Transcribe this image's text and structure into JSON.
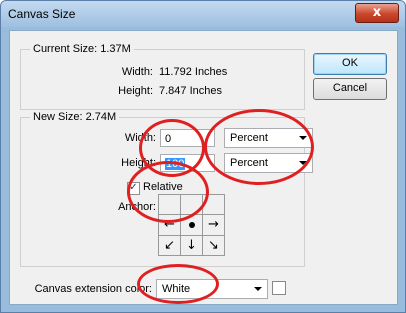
{
  "window": {
    "title": "Canvas Size",
    "close_label": "x"
  },
  "current": {
    "legend": "Current Size: 1.37M",
    "width_label": "Width:",
    "width_value": "11.792 Inches",
    "height_label": "Height:",
    "height_value": "7.847 Inches"
  },
  "new": {
    "legend": "New Size: 2.74M",
    "width_label": "Width:",
    "width_value": "0",
    "width_unit": "Percent",
    "height_label": "Height:",
    "height_value": "100",
    "height_unit": "Percent",
    "relative_label": "Relative",
    "relative_checked": true,
    "anchor_label": "Anchor:"
  },
  "buttons": {
    "ok": "OK",
    "cancel": "Cancel"
  },
  "extension": {
    "label": "Canvas extension color:",
    "value": "White"
  },
  "annotation_color": "#e02020"
}
